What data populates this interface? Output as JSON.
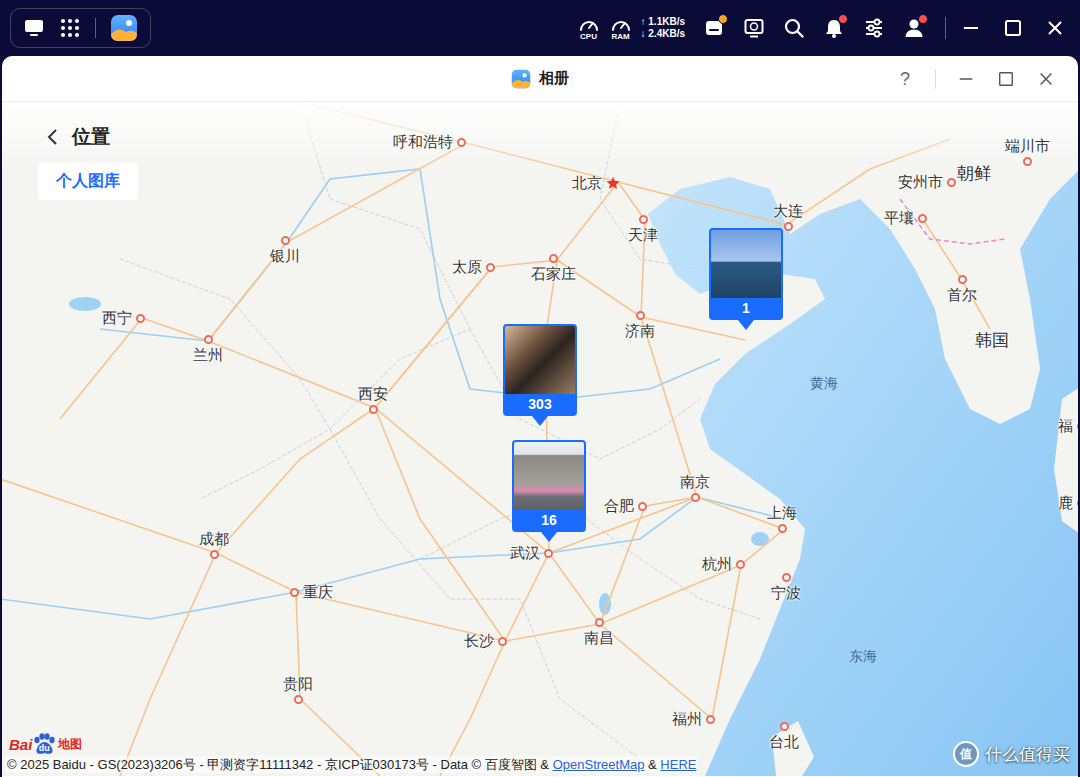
{
  "taskbar": {
    "left_icons": [
      {
        "kind": "desktop"
      },
      {
        "kind": "apps"
      },
      {
        "kind": "photos"
      }
    ],
    "meters": [
      {
        "label": "CPU"
      },
      {
        "label": "RAM"
      }
    ],
    "network": {
      "upload": "↑ 1.1KB/s",
      "download": "↓ 2.4KB/s"
    },
    "tray": [
      {
        "kind": "storage",
        "badge": true,
        "color": "#f5a623"
      },
      {
        "kind": "monitor",
        "badge": false
      },
      {
        "kind": "search",
        "badge": false
      },
      {
        "kind": "bell",
        "badge": true,
        "color": "#ff4d4f"
      },
      {
        "kind": "sliders",
        "badge": false
      },
      {
        "kind": "user",
        "badge": true,
        "color": "#ff4d4f"
      }
    ],
    "controls": [
      {
        "kind": "minimize"
      },
      {
        "kind": "maximize"
      },
      {
        "kind": "close"
      }
    ]
  },
  "window": {
    "title": "相册",
    "help": "?",
    "controls": [
      {
        "kind": "minimize"
      },
      {
        "kind": "maximize"
      },
      {
        "kind": "close"
      }
    ]
  },
  "header": {
    "title": "位置"
  },
  "library_button": "个人图库",
  "map": {
    "places": [
      {
        "name": "呼和浩特",
        "kind": "city"
      },
      {
        "name": "北京",
        "kind": "capital"
      },
      {
        "name": "天津",
        "kind": "city"
      },
      {
        "name": "大连",
        "kind": "city"
      },
      {
        "name": "安州市",
        "kind": "city"
      },
      {
        "name": "朝鲜",
        "kind": "region"
      },
      {
        "name": "端川市",
        "kind": "city"
      },
      {
        "name": "平壤",
        "kind": "city"
      },
      {
        "name": "首尔",
        "kind": "city"
      },
      {
        "name": "韩国",
        "kind": "region"
      },
      {
        "name": "银川",
        "kind": "city"
      },
      {
        "name": "太原",
        "kind": "city"
      },
      {
        "name": "石家庄",
        "kind": "city"
      },
      {
        "name": "济南",
        "kind": "city"
      },
      {
        "name": "西宁",
        "kind": "city"
      },
      {
        "name": "兰州",
        "kind": "city"
      },
      {
        "name": "西安",
        "kind": "city"
      },
      {
        "name": "黄海",
        "kind": "sea"
      },
      {
        "name": "南京",
        "kind": "city"
      },
      {
        "name": "合肥",
        "kind": "city"
      },
      {
        "name": "上海",
        "kind": "city"
      },
      {
        "name": "武汉",
        "kind": "city"
      },
      {
        "name": "杭州",
        "kind": "city"
      },
      {
        "name": "宁波",
        "kind": "city"
      },
      {
        "name": "成都",
        "kind": "city"
      },
      {
        "name": "重庆",
        "kind": "city"
      },
      {
        "name": "长沙",
        "kind": "city"
      },
      {
        "name": "南昌",
        "kind": "city"
      },
      {
        "name": "东海",
        "kind": "sea"
      },
      {
        "name": "贵阳",
        "kind": "city"
      },
      {
        "name": "福州",
        "kind": "city"
      },
      {
        "name": "台北",
        "kind": "city"
      },
      {
        "name": "福",
        "kind": "city"
      },
      {
        "name": "鹿",
        "kind": "city"
      }
    ],
    "pins": [
      {
        "count": "1"
      },
      {
        "count": "303"
      },
      {
        "count": "16"
      }
    ]
  },
  "attribution": {
    "logo": {
      "bai": "Bai",
      "du": "du",
      "map": "地图"
    },
    "parts": [
      {
        "kind": "text",
        "text": "© 2025 Baidu - GS(2023)3206号 - 甲测资字11111342 - 京ICP证030173号 - Data © 百度智图 & "
      },
      {
        "kind": "link",
        "text": "OpenStreetMap"
      },
      {
        "kind": "text",
        "text": " & "
      },
      {
        "kind": "link",
        "text": "HERE"
      }
    ]
  },
  "watermark": {
    "icon": "值",
    "text": "什么值得买"
  }
}
